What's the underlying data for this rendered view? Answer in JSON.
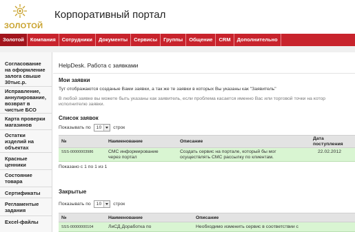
{
  "header": {
    "logo_text": "ЗОЛОТОЙ",
    "portal_title": "Корпоративный портал"
  },
  "nav": {
    "items": [
      "Золотой",
      "Компания",
      "Сотрудники",
      "Документы",
      "Сервисы",
      "Группы",
      "Общение",
      "CRM",
      "Дополнительно"
    ],
    "active_index": 0
  },
  "sidebar": {
    "items": [
      [
        "Согласование",
        "на оформление",
        "залога свыше",
        "30тыс.р."
      ],
      [
        "Исправление,",
        "аннулирование,",
        "возврат в",
        "чистые БСО"
      ],
      [
        "Карта проверки",
        "магазинов"
      ],
      [
        "Остатки",
        "изделий на",
        "объектах"
      ],
      [
        "Красные",
        "ценники"
      ],
      [
        "Состояние",
        "товара"
      ],
      [
        "Сертификаты"
      ],
      [
        "Регламентые",
        "задания"
      ],
      [
        "Excel-файлы"
      ]
    ]
  },
  "main": {
    "page_title": "HelpDesk. Работа с заявками",
    "my_requests_heading": "Мои заявки",
    "intro_text": "Тут отображаются созданые Вами заявки, а так же те заявки в которых Вы указаны как \"Заявитель\"",
    "note_line1": "В любой заявке вы можете быть указаны как заявитель, если проблема касается именно Вас или торговой точки на котор",
    "note_line2": "исполнителю заявки.",
    "list_heading": "Список заявок",
    "closed_heading": "Закрытые",
    "show_label": "Показывать по",
    "show_value": "10",
    "rows_label": "строк",
    "table_info": "Показано с 1 по 1 из 1"
  },
  "columns": {
    "num": "№",
    "name": "Наименование",
    "desc": "Описание",
    "date_line1": "Дата",
    "date_line2": "поступления"
  },
  "open_requests": [
    {
      "num": "SSS-00000003986",
      "name_line1": "СМС информирование",
      "name_line2": "через портал",
      "desc_line1": "Создать сервис на портале, который бы мог",
      "desc_line2": "осуществлять СМС рассылку по клиентам.",
      "date": "22.02.2012"
    }
  ],
  "closed_requests": [
    {
      "num": "SSS-00000000104",
      "name_line1": "ЛиСД Доработка по",
      "desc_line1": "Необходимо изменить сервис в соответствии с"
    }
  ],
  "colors": {
    "nav_bg": "#c8232c",
    "nav_active": "#a2151d",
    "row_highlight": "#d9f5d2",
    "logo_gold": "#c8a12a"
  }
}
